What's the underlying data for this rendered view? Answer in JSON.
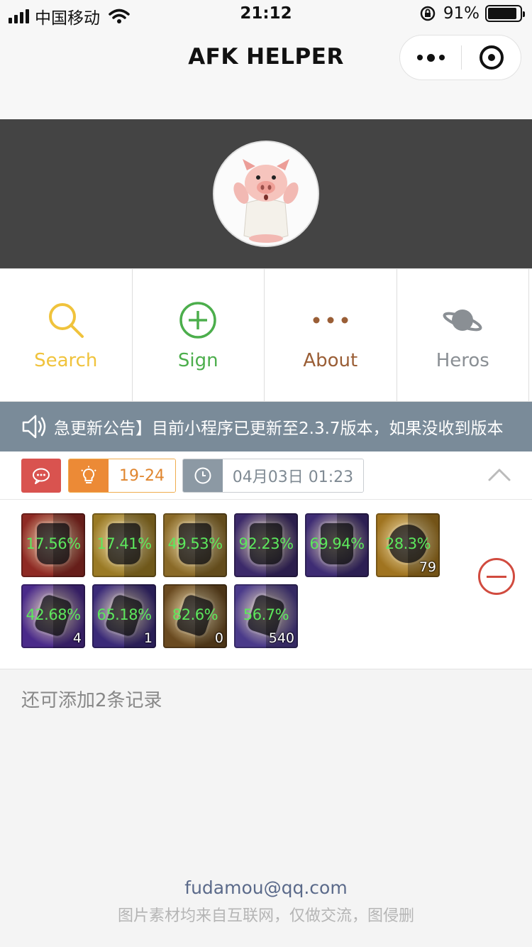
{
  "status_bar": {
    "carrier": "中国移动",
    "time": "21:12",
    "battery_text": "91%",
    "battery_level": 0.91
  },
  "nav": {
    "title": "AFK HELPER"
  },
  "profile": {
    "avatar_icon": "pig-avatar-icon"
  },
  "menu": {
    "items": [
      {
        "label": "Search",
        "icon": "search-icon",
        "color": "#f0c33c"
      },
      {
        "label": "Sign",
        "icon": "plus-circle-icon",
        "color": "#4cae4c"
      },
      {
        "label": "About",
        "icon": "more-dots-icon",
        "color": "#9a5e36"
      },
      {
        "label": "Heros",
        "icon": "planet-icon",
        "color": "#8a8f94"
      }
    ]
  },
  "notice": {
    "icon": "speaker-icon",
    "text": "急更新公告】目前小程序已更新至2.3.7版本，如果没收到版本"
  },
  "record": {
    "stage": "19-24",
    "time": "04月03日 01:23",
    "items": [
      {
        "percent": "17.56%",
        "count": "",
        "bg": "#8e2a24"
      },
      {
        "percent": "17.41%",
        "count": "",
        "bg": "#9a7a25"
      },
      {
        "percent": "49.53%",
        "count": "",
        "bg": "#8a6a28"
      },
      {
        "percent": "92.23%",
        "count": "",
        "bg": "#3c2a6a"
      },
      {
        "percent": "69.94%",
        "count": "",
        "bg": "#3e2c74"
      },
      {
        "percent": "28.3%",
        "count": "79",
        "bg": "#a07420"
      },
      {
        "percent": "42.68%",
        "count": "4",
        "bg": "#4a2a8a"
      },
      {
        "percent": "65.18%",
        "count": "1",
        "bg": "#3a2a78"
      },
      {
        "percent": "82.6%",
        "count": "0",
        "bg": "#6a4a20"
      },
      {
        "percent": "56.7%",
        "count": "540",
        "bg": "#4a3a8a"
      }
    ],
    "remaining_text": "还可添加2条记录"
  },
  "footer": {
    "email": "fudamou@qq.com",
    "note": "图片素材均来自互联网，仅做交流，图侵删"
  }
}
